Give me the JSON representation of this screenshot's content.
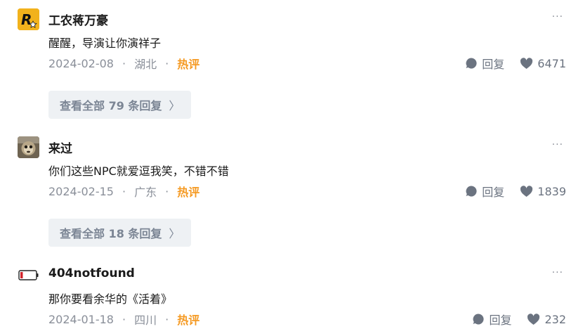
{
  "comments": [
    {
      "author": "工农蒋万豪",
      "text": "醒醒，导演让你演祥子",
      "date": "2024-02-08",
      "region": "湖北",
      "hot": "热评",
      "reply_label": "回复",
      "likes": "6471",
      "view_replies": "查看全部 79 条回复",
      "avatar": "r-logo"
    },
    {
      "author": "来过",
      "text": "你们这些NPC就爱逗我笑，不错不错",
      "date": "2024-02-15",
      "region": "广东",
      "hot": "热评",
      "reply_label": "回复",
      "likes": "1839",
      "view_replies": "查看全部 18 条回复",
      "avatar": "monkey-photo"
    },
    {
      "author": "404notfound",
      "text": "那你要看余华的《活着》",
      "date": "2024-01-18",
      "region": "四川",
      "hot": "热评",
      "reply_label": "回复",
      "likes": "232",
      "avatar": "low-battery"
    }
  ],
  "ui": {
    "more": "···",
    "dot": "·",
    "chevron": "〉"
  },
  "colors": {
    "hot": "#f59a23",
    "muted": "#8a8f99",
    "reply_bg": "#eef1f4",
    "avatar_gold": "#f2b21c"
  }
}
